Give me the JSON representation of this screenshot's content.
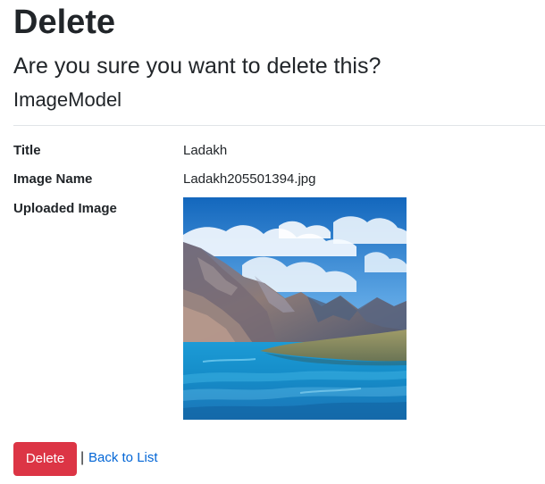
{
  "page": {
    "title": "Delete",
    "question": "Are you sure you want to delete this?",
    "model_name": "ImageModel"
  },
  "details": [
    {
      "label": "Title",
      "value": "Ladakh"
    },
    {
      "label": "Image Name",
      "value": "Ladakh205501394.jpg"
    },
    {
      "label": "Uploaded Image",
      "image": "mountain-lake-photo"
    }
  ],
  "actions": {
    "delete_label": "Delete",
    "separator": "|",
    "back_label": "Back to List"
  },
  "colors": {
    "danger": "#dc3545",
    "link": "#0366d6",
    "text": "#212529",
    "divider": "#e1e4e8"
  }
}
